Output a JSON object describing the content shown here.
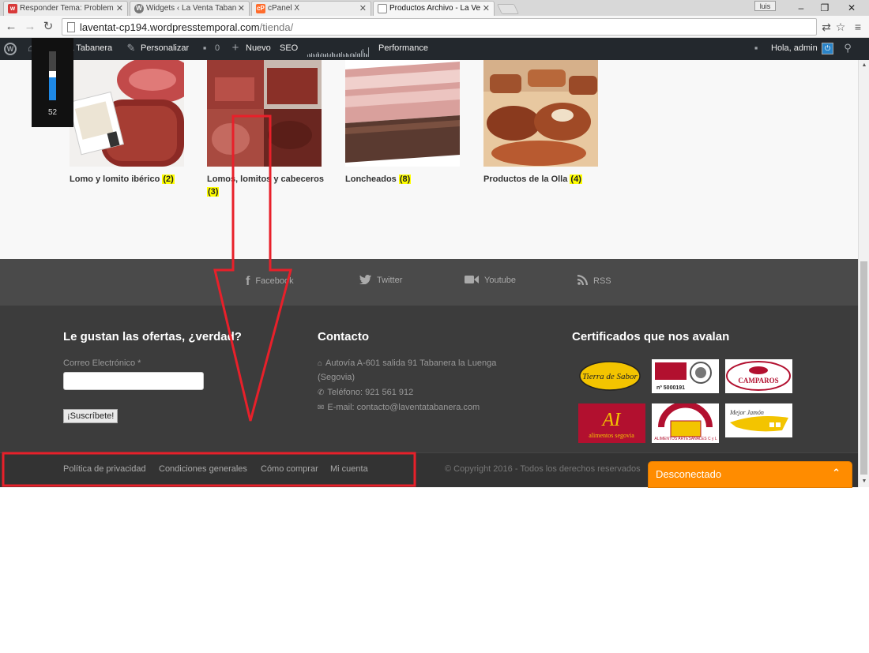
{
  "browser": {
    "tabs": [
      {
        "title": "Responder Tema: Problem",
        "favicon": "wordpress-support-icon",
        "color": "#d83a3a",
        "active": false
      },
      {
        "title": "Widgets ‹ La Venta Taban",
        "favicon": "wordpress-icon",
        "color": "#777777",
        "active": false
      },
      {
        "title": "cPanel X",
        "favicon": "cpanel-icon",
        "color": "#ff6c2c",
        "active": false
      },
      {
        "title": "Productos Archivo - La Ve",
        "favicon": "page-icon",
        "color": "#888888",
        "active": true
      }
    ],
    "user_badge": "luis",
    "address": {
      "host": "laventat-cp194.wordpresstemporal.com",
      "path": "/tienda/"
    }
  },
  "adminbar": {
    "site_name": "La Venta Tabanera",
    "customize": "Personalizar",
    "comments_count": "0",
    "new_label": "Nuevo",
    "seo": "SEO",
    "performance": "Performance",
    "greeting": "Hola, admin"
  },
  "fps_widget": {
    "value": "52"
  },
  "products": [
    {
      "name": "Lomo y lomito ibérico",
      "count": "(2)"
    },
    {
      "name": "Lomos, lomitos y cabeceros",
      "count": "(3)"
    },
    {
      "name": "Loncheados",
      "count": "(8)"
    },
    {
      "name": "Productos de la Olla",
      "count": "(4)"
    }
  ],
  "social": [
    {
      "label": "Facebook",
      "icon": "facebook-icon"
    },
    {
      "label": "Twitter",
      "icon": "twitter-icon"
    },
    {
      "label": "Youtube",
      "icon": "youtube-icon"
    },
    {
      "label": "RSS",
      "icon": "rss-icon"
    }
  ],
  "footer": {
    "newsletter": {
      "heading": "Le gustan las ofertas, ¿verdad?",
      "field_label": "Correo Electrónico *",
      "email_value": "",
      "button": "¡Suscríbete!"
    },
    "contact": {
      "heading": "Contacto",
      "address_line1": "Autovía A-601 salida 91 Tabanera la Luenga",
      "address_line2": "(Segovia)",
      "phone": "Teléfono: 921 561 912",
      "email": "E-mail: contacto@laventatabanera.com"
    },
    "certificates": {
      "heading": "Certificados que nos avalan",
      "logos": [
        {
          "name": "tierra-de-sabor",
          "text": "Tierra de Sabor"
        },
        {
          "name": "bureau-veritas",
          "text": "nº 5000191"
        },
        {
          "name": "camparos",
          "text": "CAMPAROS"
        },
        {
          "name": "alimentos-de-segovia",
          "text": "alimentos segovia"
        },
        {
          "name": "alimentos-artesanales-cyl",
          "text": "ALIMENTOS ARTESANALES C y L"
        },
        {
          "name": "mejor-jamon",
          "text": "Mejor Jamón"
        }
      ]
    }
  },
  "bottom_links": [
    "Política de privacidad",
    "Condiciones generales",
    "Cómo comprar",
    "Mi cuenta"
  ],
  "copyright": "© Copyright 2016 - Todos los derechos reservados",
  "chat": {
    "status": "Desconectado"
  },
  "colors": {
    "accent": "#ff8c00",
    "highlight": "#ffff00",
    "annotation": "#e8202a",
    "adminbar": "#23282d"
  }
}
